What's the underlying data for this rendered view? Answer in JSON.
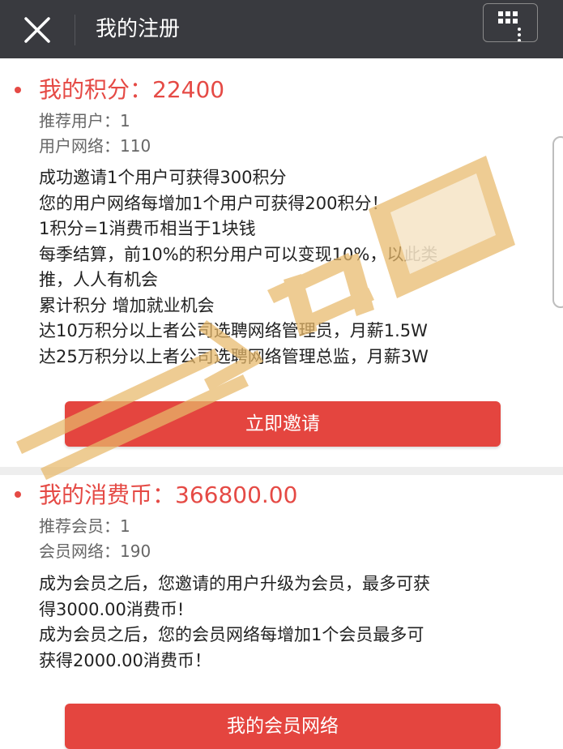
{
  "header": {
    "title": "我的注册",
    "close_icon": "close-icon",
    "menu_icon": "more-menu-icon"
  },
  "points": {
    "headline": "我的积分：22400",
    "referred_users": "推荐用户：1",
    "user_network": "用户网络：110",
    "lines": [
      "成功邀请1个用户可获得300积分",
      "您的用户网络每增加1个用户可获得200积分！",
      "1积分=1消费币相当于1块钱",
      "每季结算，前10%的积分用户可以变现10%，以此类",
      "推，人人有机会",
      "累计积分 增加就业机会",
      "达10万积分以上者公司选聘网络管理员，月薪1.5W",
      "达25万积分以上者公司选聘网络管理总监，月薪3W"
    ],
    "button_label": "立即邀请"
  },
  "coins": {
    "headline": "我的消费币：366800.00",
    "referred_members": "推荐会员：1",
    "member_network": "会员网络：190",
    "lines": [
      "成为会员之后，您邀请的用户升级为会员，最多可获",
      "得3000.00消费币!",
      "成为会员之后，您的会员网络每增加1个会员最多可",
      "获得2000.00消费币！"
    ],
    "button_label": "我的会员网络"
  },
  "colors": {
    "accent": "#e54a45",
    "button": "#e4453f",
    "topbar": "#393a3f",
    "watermark": "#e8b96a"
  }
}
